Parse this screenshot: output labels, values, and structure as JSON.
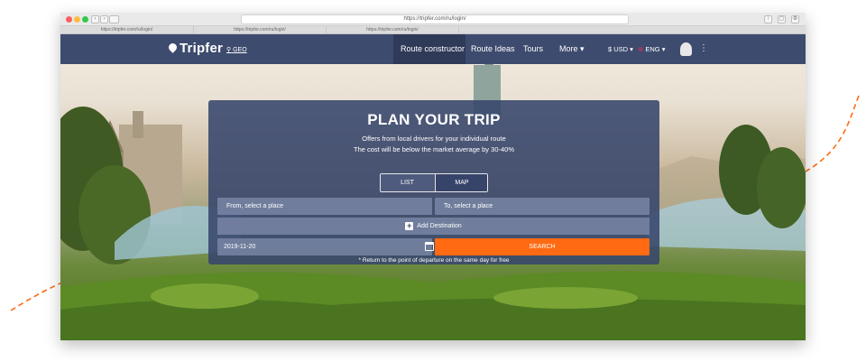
{
  "browser": {
    "url": "https://tripfer.com/ru/login/",
    "tabs": [
      "https://tripfer.com/ru/login/",
      "https://tripfer.com/ru/login/",
      "https://tripfer.com/ru/login/"
    ]
  },
  "nav": {
    "logo": "Tripfer",
    "geo": "GEO",
    "items": [
      {
        "label": "Route constructor",
        "active": true
      },
      {
        "label": "Route Ideas"
      },
      {
        "label": "Tours"
      },
      {
        "label": "More ▾"
      }
    ],
    "currency": "$ USD ▾",
    "language": "ENG ▾",
    "menu_dots": "⋮"
  },
  "panel": {
    "title": "PLAN YOUR TRIP",
    "subtitle1": "Offers from local drivers for your individual route",
    "subtitle2": "The cost will be below the market average by 30-40%",
    "toggle": {
      "list": "LIST",
      "map": "MAP"
    },
    "from_placeholder": "From, select a place",
    "to_placeholder": "To, select a place",
    "add_destination": "Add Destination",
    "date_value": "2019-11-20",
    "search_label": "SEARCH",
    "note": "* Return to the point of departure on the same day for free"
  },
  "colors": {
    "navbar": "#3d4b6e",
    "accent": "#ff6a13",
    "panel": "#37466c"
  }
}
